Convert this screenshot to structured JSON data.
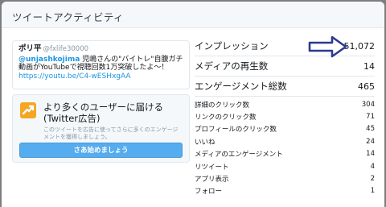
{
  "modal": {
    "title": "ツイートアクティビティ"
  },
  "tweet": {
    "author": "ポリ平",
    "handle": "@fxlife30000",
    "mention": "@unjashkojima",
    "text": " 児嶋さんの\"バイトレ\"自腹ガチ動画がYouTubeで視聴回数1万突破したよ〜！",
    "link": "https://youtu.be/C4-wESHxgAA"
  },
  "promo": {
    "icon": "promote-chart-icon",
    "title": "より多くのユーザーに届ける(Twitter広告)",
    "description": "このツイートを広告に使ってさらに多くのエンゲージメントを獲得しましょう。",
    "button_label": "さあ始めましょう"
  },
  "metrics": {
    "main": [
      {
        "label": "インプレッション",
        "value": "51,072"
      },
      {
        "label": "メディアの再生数",
        "value": "14"
      },
      {
        "label": "エンゲージメント総数",
        "value": "465"
      }
    ],
    "details": [
      {
        "label": "詳細のクリック数",
        "value": "304"
      },
      {
        "label": "リンクのクリック数",
        "value": "71"
      },
      {
        "label": "プロフィールのクリック数",
        "value": "45"
      },
      {
        "label": "いいね",
        "value": "24"
      },
      {
        "label": "メディアのエンゲージメント",
        "value": "14"
      },
      {
        "label": "リツイート",
        "value": "4"
      },
      {
        "label": "アプリ表示",
        "value": "2"
      },
      {
        "label": "フォロー",
        "value": "1"
      }
    ]
  },
  "annotation": {
    "icon": "arrow-right-icon",
    "color": "#2b3a8f"
  }
}
